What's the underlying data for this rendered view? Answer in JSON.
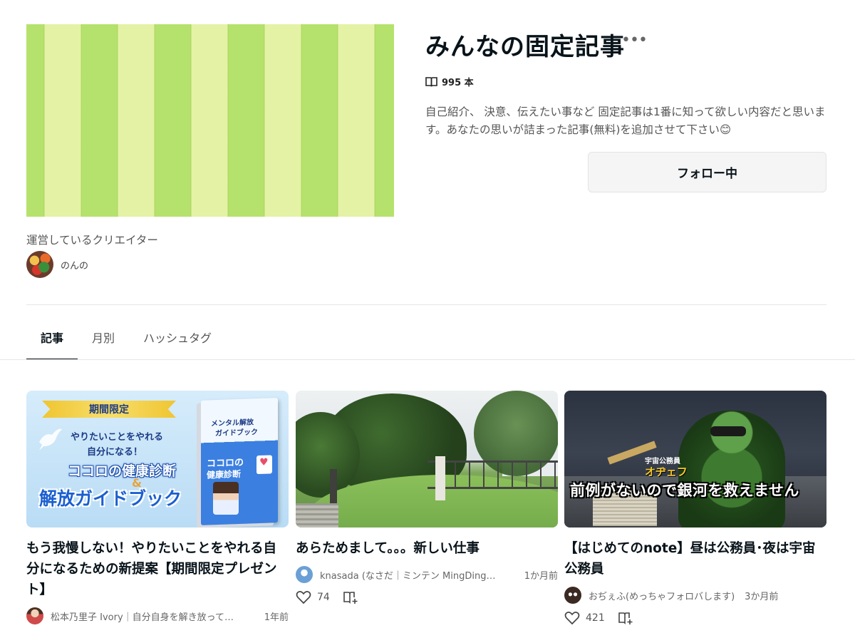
{
  "magazine": {
    "title": "みんなの固定記事",
    "more_label": "•••",
    "count_label": "995 本",
    "description": "自己紹介、 決意、伝えたい事など 固定記事は1番に知って欲しい内容だと思います。あなたの思いが詰まった記事(無料)を追加させて下さい😊",
    "follow_button": "フォロー中",
    "creators_heading": "運営しているクリエイター",
    "creator_name": "のんの"
  },
  "tabs": [
    {
      "label": "記事",
      "active": true
    },
    {
      "label": "月別",
      "active": false
    },
    {
      "label": "ハッシュタグ",
      "active": false
    }
  ],
  "articles": [
    {
      "title": "もう我慢しない！やりたいことをやれる自分になるための新提案【期間限定プレゼント】",
      "author": "松本乃里子 Ivory｜自分自身を解き放って…",
      "time": "1年前",
      "likes": "",
      "thumb": {
        "banner": "期間限定",
        "line1": "やりたいことをやれる",
        "line2": "自分になる！",
        "line3": "ココロの健康診断",
        "amp": "&",
        "line4": "解放ガイドブック",
        "book_top1": "メンタル解放",
        "book_top2": "ガイドブック",
        "book_bottom1": "ココロの",
        "book_bottom2": "健康診断"
      }
    },
    {
      "title": "あらためまして。。。新しい仕事",
      "author": "knasada (なさだ｜ミンテン MingDing…",
      "time": "1か月前",
      "likes": "74"
    },
    {
      "title": "【はじめてのnote】昼は公務員･夜は宇宙公務員",
      "author": "おぢぇふ(めっちゃフォロバします)",
      "time": "3か月前",
      "likes": "421",
      "thumb": {
        "label_a": "宇宙公務員",
        "label_b": "オヂェフ",
        "headline": "前例がないので銀河を救えません"
      }
    }
  ],
  "colors": {
    "cover_dark": "#b5e26c",
    "cover_light": "#e4f2a6",
    "text": "#08131a",
    "muted": "#555555"
  }
}
